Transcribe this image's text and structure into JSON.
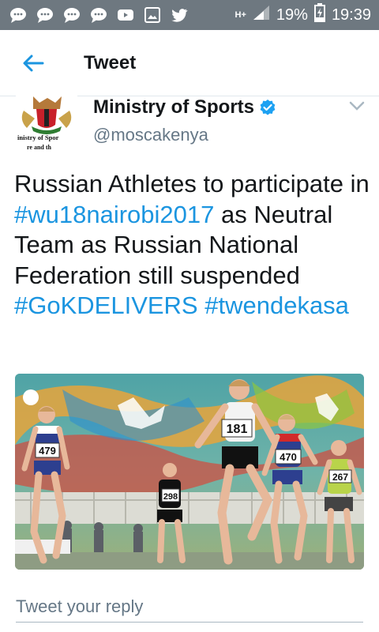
{
  "status_bar": {
    "network_label": "H+",
    "battery": "19%",
    "time": "19:39",
    "left_icons": [
      "message-icon",
      "message-icon",
      "message-icon",
      "message-icon",
      "youtube-icon",
      "gallery-icon",
      "twitter-icon"
    ]
  },
  "header": {
    "title": "Tweet"
  },
  "tweet": {
    "author_name": "Ministry of Sports",
    "handle": "@moscakenya",
    "avatar_text_line1": "inistry of Spor",
    "avatar_text_line2": "re and th",
    "text_plain_1": "Russian Athletes to participate in ",
    "hashtag_1": "#wu18nairobi2017",
    "text_plain_2": " as Neutral Team as Russian National Federation still suspended ",
    "hashtag_2": "#GoKDELIVERS",
    "hashtag_3": "#twendekasa",
    "photo_bibs": [
      "479",
      "298",
      "181",
      "470",
      "267"
    ]
  },
  "reply": {
    "placeholder": "Tweet your reply"
  },
  "colors": {
    "accent": "#1b95e0",
    "status_bar": "#6e7880",
    "text": "#14171a",
    "secondary": "#657786"
  }
}
